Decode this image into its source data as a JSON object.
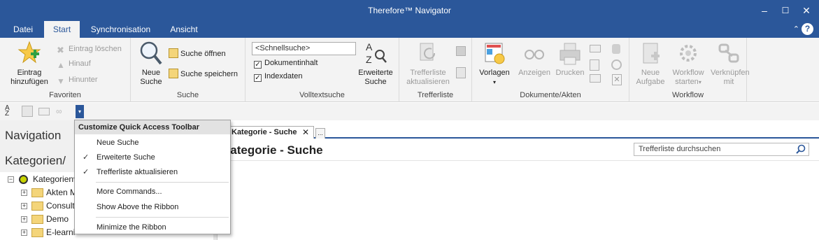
{
  "window": {
    "title": "Therefore™ Navigator",
    "minimize": "–",
    "maximize": "☐",
    "close": "✕"
  },
  "tabs": [
    "Datei",
    "Start",
    "Synchronisation",
    "Ansicht"
  ],
  "active_tab": "Start",
  "ribbon_controls": {
    "collapse": "⌃",
    "help": "?"
  },
  "ribbon": {
    "favoriten": {
      "label": "Favoriten",
      "add": "Eintrag hinzufügen",
      "delete": "Eintrag löschen",
      "up": "Hinauf",
      "down": "Hinunter"
    },
    "suche": {
      "label": "Suche",
      "new_search": "Neue Suche",
      "open_search": "Suche öffnen",
      "save_search": "Suche speichern"
    },
    "volltextsuche": {
      "label": "Volltextsuche",
      "quicksearch_placeholder": "<Schnellsuche>",
      "opt_doc_content": "Dokumentinhalt",
      "opt_index_data": "Indexdaten",
      "advanced_search": "Erweiterte Suche"
    },
    "trefferliste": {
      "label": "Trefferliste",
      "refresh": "Trefferliste aktualisieren"
    },
    "dokumente": {
      "label": "Dokumente/Akten",
      "templates": "Vorlagen",
      "view": "Anzeigen",
      "print": "Drucken"
    },
    "workflow": {
      "label": "Workflow",
      "new_task": "Neue Aufgabe",
      "start_workflow": "Workflow starten",
      "link_with": "Verknüpfen mit"
    }
  },
  "nav": {
    "title": "Navigation",
    "categories_title": "Kategorien/",
    "tree": [
      {
        "label": "Kategorienv",
        "level": 0,
        "expander": "⊟"
      },
      {
        "label": "Akten M",
        "level": 1,
        "expander": "+"
      },
      {
        "label": "Consult",
        "level": 1,
        "expander": "+"
      },
      {
        "label": "Demo",
        "level": 1,
        "expander": "+"
      },
      {
        "label": "E-learni",
        "level": 1,
        "expander": "+"
      }
    ]
  },
  "document": {
    "tab_label": "Kategorie - Suche",
    "tab_close": "✕",
    "tab_more": "...",
    "title": "Kategorie - Suche",
    "result_search_placeholder": "Trefferliste durchsuchen"
  },
  "qat_menu": {
    "header": "Customize Quick Access Toolbar",
    "items": [
      {
        "label": "Neue Suche",
        "checked": false
      },
      {
        "label": "Erweiterte Suche",
        "checked": true
      },
      {
        "label": "Trefferliste aktualisieren",
        "checked": true
      },
      {
        "label": "More Commands...",
        "checked": false
      },
      {
        "label": "Show Above the Ribbon",
        "checked": false
      },
      {
        "label": "Minimize the Ribbon",
        "checked": false
      }
    ],
    "checkmark": "✓"
  },
  "colors": {
    "accent": "#2b579a",
    "ribbon_bg": "#f3f3f3",
    "disabled_text": "#9a9a9a"
  }
}
